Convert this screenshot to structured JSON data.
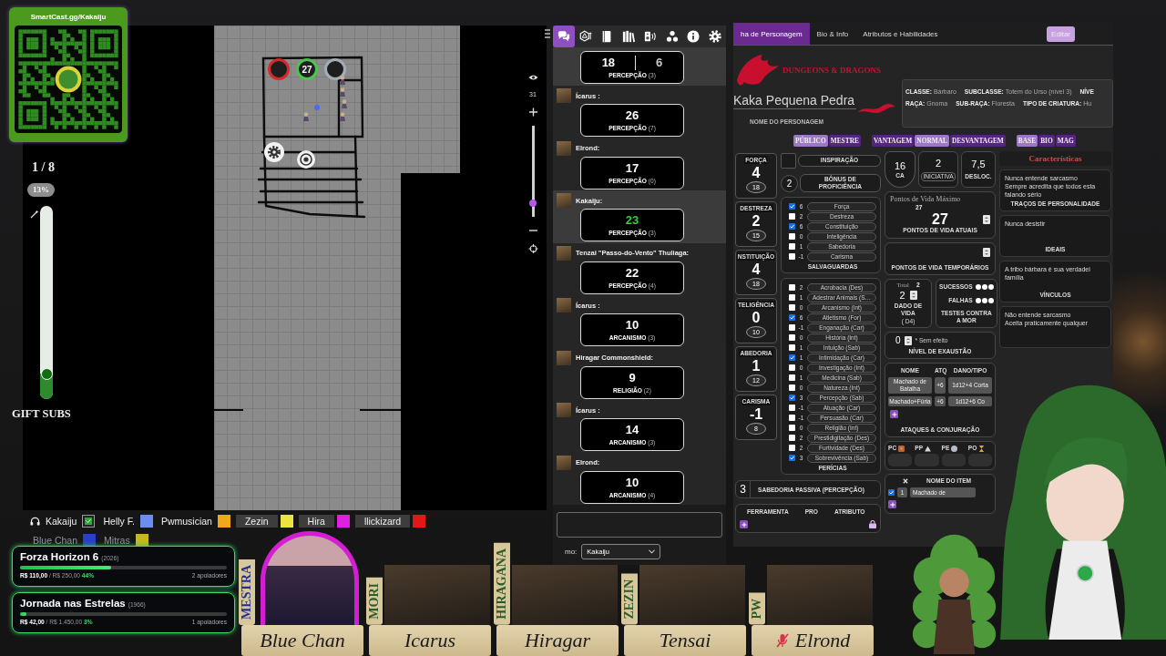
{
  "qr_widget": {
    "url": "SmartCast.gg/Kakaiju"
  },
  "gift_subs": {
    "count": "1 / 8",
    "percent": "13%",
    "level": 0.13,
    "label": "GIFT SUBS"
  },
  "map": {
    "tokens": [
      {
        "color": "#d42a2a"
      },
      {
        "color": "#4cc24f",
        "label": "27"
      },
      {
        "color": "#a3adb9"
      }
    ],
    "zoom_slider": {
      "value": "31",
      "level": 0.12
    }
  },
  "chat": {
    "tabs": [
      {
        "selected": true
      },
      {
        "selected": false
      },
      {
        "selected": false
      },
      {
        "selected": false
      },
      {
        "selected": false
      },
      {
        "selected": false
      },
      {
        "selected": false
      },
      {
        "selected": false
      }
    ],
    "messages": [
      {
        "results": [
          "18",
          "6"
        ],
        "skill": "PERCEPÇÃO",
        "bonus": "(3)",
        "highlighted": true,
        "crit": false
      },
      {
        "speaker": "Ícarus :",
        "results": [
          "26"
        ],
        "skill": "PERCEPÇÃO",
        "bonus": "(7)",
        "highlighted": false,
        "crit": false
      },
      {
        "speaker": "Elrond:",
        "results": [
          "17"
        ],
        "skill": "PERCEPÇÃO",
        "bonus": "(0)",
        "highlighted": false,
        "crit": false
      },
      {
        "speaker": "Kakaiju:",
        "results": [
          "23"
        ],
        "skill": "PERCEPÇÃO",
        "bonus": "(3)",
        "highlighted": true,
        "crit": true
      },
      {
        "speaker": "Tenzai \"Passo-do-Vento\" Thuliaga:",
        "results": [
          "22"
        ],
        "skill": "PERCEPÇÃO",
        "bonus": "(4)",
        "highlighted": false,
        "crit": false
      },
      {
        "speaker": "Ícarus :",
        "results": [
          "10"
        ],
        "skill": "ARCANISMO",
        "bonus": "(3)",
        "highlighted": false,
        "crit": false
      },
      {
        "speaker": "Hiragar Commonshield:",
        "results": [
          "9"
        ],
        "skill": "RELIGIÃO",
        "bonus": "(2)",
        "highlighted": false,
        "crit": false
      },
      {
        "speaker": "Ícarus :",
        "results": [
          "14"
        ],
        "skill": "ARCANISMO",
        "bonus": "(3)",
        "highlighted": false,
        "crit": false
      },
      {
        "speaker": "Elrond:",
        "results": [
          "10"
        ],
        "skill": "ARCANISMO",
        "bonus": "(4)",
        "highlighted": false,
        "crit": false
      }
    ],
    "speaking_as": {
      "label": "mo:",
      "value": "Kakaiju"
    }
  },
  "character_sheet": {
    "tabs": [
      {
        "label": "ha de Personagem",
        "selected": true
      },
      {
        "label": "Bio & Info",
        "selected": false
      },
      {
        "label": "Atributos e Habilidades",
        "selected": false
      }
    ],
    "edit_button": "Editar",
    "logo_text": "DUNGEONS & DRAGONS",
    "name": "Kaka Pequena Pedra",
    "name_label": "NOME DO PERSONAGEM",
    "details": [
      [
        {
          "label": "CLASSE:",
          "value": "Bárbaro"
        },
        {
          "label": "SUBCLASSE:",
          "value": "Totem do Urso (nível 3)"
        },
        {
          "label": "NÍVE"
        }
      ],
      [
        {
          "label": "RAÇA:",
          "value": "Gnoma"
        },
        {
          "label": "SUB-RAÇA:",
          "value": "Floresta"
        },
        {
          "label": "TIPO DE CRIATURA:",
          "value": "Hu"
        }
      ]
    ],
    "toggle_groups": [
      [
        {
          "label": "PÚBLICO",
          "selected": true
        },
        {
          "label": "MESTRE",
          "selected": false
        }
      ],
      [
        {
          "label": "VANTAGEM",
          "selected": false
        },
        {
          "label": "NORMAL",
          "selected": true
        },
        {
          "label": "DESVANTAGEM",
          "selected": false
        }
      ],
      [
        {
          "label": "BASE",
          "selected": true
        },
        {
          "label": "BIO",
          "selected": false
        },
        {
          "label": "MAG",
          "selected": false
        }
      ]
    ],
    "abilities": [
      {
        "name": "FORÇA",
        "modifier": "4",
        "score": "18"
      },
      {
        "name": "DESTREZA",
        "modifier": "2",
        "score": "15"
      },
      {
        "name": "NSTITUIÇÃO",
        "modifier": "4",
        "score": "18"
      },
      {
        "name": "TELIGÊNCIA",
        "modifier": "0",
        "score": "10"
      },
      {
        "name": "ABEDORIA",
        "modifier": "1",
        "score": "12"
      },
      {
        "name": "CARISMA",
        "modifier": "-1",
        "score": "8"
      }
    ],
    "inspiration": "INSPIRAÇÃO",
    "proficiency": {
      "value": "2",
      "label": "BÔNUS DE PROFICIÊNCIA"
    },
    "saving_throws": {
      "title": "SALVAGUARDAS",
      "items": [
        {
          "checked": true,
          "value": "6",
          "name": "Força"
        },
        {
          "checked": false,
          "value": "2",
          "name": "Destreza"
        },
        {
          "checked": true,
          "value": "6",
          "name": "Constituição"
        },
        {
          "checked": false,
          "value": "0",
          "name": "Inteligência"
        },
        {
          "checked": false,
          "value": "1",
          "name": "Sabedoria"
        },
        {
          "checked": false,
          "value": "-1",
          "name": "Carisma"
        }
      ]
    },
    "skills": {
      "title": "PERÍCIAS",
      "items": [
        {
          "checked": false,
          "value": "2",
          "name": "Acrobacia (Des)"
        },
        {
          "checked": false,
          "value": "1",
          "name": "Adestrar Animais (S…"
        },
        {
          "checked": false,
          "value": "0",
          "name": "Arcanismo (Int)"
        },
        {
          "checked": true,
          "value": "6",
          "name": "Atletismo (For)"
        },
        {
          "checked": false,
          "value": "-1",
          "name": "Enganação (Car)"
        },
        {
          "checked": false,
          "value": "0",
          "name": "História (Int)"
        },
        {
          "checked": false,
          "value": "1",
          "name": "Intuição (Sab)"
        },
        {
          "checked": true,
          "value": "1",
          "name": "Intimidação (Car)"
        },
        {
          "checked": false,
          "value": "0",
          "name": "Investigação (Int)"
        },
        {
          "checked": false,
          "value": "1",
          "name": "Medicina (Sab)"
        },
        {
          "checked": false,
          "value": "0",
          "name": "Natureza (Int)"
        },
        {
          "checked": true,
          "value": "3",
          "name": "Percepção (Sab)"
        },
        {
          "checked": false,
          "value": "-1",
          "name": "Atuação (Car)"
        },
        {
          "checked": false,
          "value": "-1",
          "name": "Persuasão (Car)"
        },
        {
          "checked": false,
          "value": "0",
          "name": "Religião (Int)"
        },
        {
          "checked": false,
          "value": "2",
          "name": "Prestidigitação (Des)"
        },
        {
          "checked": false,
          "value": "2",
          "name": "Furtividade (Des)"
        },
        {
          "checked": true,
          "value": "3",
          "name": "Sobrevivência (Sab)"
        }
      ]
    },
    "passive_perception": {
      "value": "3",
      "label": "SABEDORIA PASSIVA (PERCEPÇÃO)"
    },
    "tools": {
      "columns": [
        "FERRAMENTA",
        "PRO",
        "ATRIBUTO"
      ]
    },
    "armor_class": {
      "value": "16",
      "label": "CA"
    },
    "initiative": {
      "value": "2",
      "label": "INICIATIVA"
    },
    "speed": {
      "value": "7,5",
      "label": "DESLOC."
    },
    "hit_points": {
      "max_label": "Pontos de Vida Máximo",
      "max": "27",
      "current": "27",
      "current_label": "PONTOS DE VIDA ATUAIS",
      "temp_label": "PONTOS DE VIDA TEMPORÁRIOS"
    },
    "hit_dice": {
      "total_label": "Total",
      "total": "2",
      "value": "2",
      "label": "DADO DE VIDA",
      "die": "( D4)"
    },
    "death_saves": {
      "successes_label": "SUCESSOS",
      "successes": [
        {
          "checked": false
        },
        {
          "checked": false
        },
        {
          "checked": false
        }
      ],
      "failures_label": "FALHAS",
      "failures": [
        {
          "checked": false
        },
        {
          "checked": false
        },
        {
          "checked": false
        }
      ],
      "label": "TESTES CONTRA A MOR"
    },
    "exhaustion": {
      "value": "0",
      "note": "* Sem efeito",
      "label": "NÍVEL DE EXAUSTÃO"
    },
    "attacks": {
      "columns": [
        "NOME",
        "ATQ",
        "DANO/TIPO"
      ],
      "rows": [
        {
          "name": "Machado de Batalha",
          "attack": "+6",
          "damage": "1d12+4 Corta"
        },
        {
          "name": "Machado+Fúria",
          "attack": "+6",
          "damage": "1d12+6 Co"
        }
      ],
      "title": "ATAQUES & CONJURAÇÃO"
    },
    "coins": [
      "PC",
      "PP",
      "PE",
      "PO"
    ],
    "inventory": {
      "column": "NOME DO ITEM",
      "items": [
        {
          "checked": true,
          "quantity": "1",
          "name": "Machado de"
        }
      ]
    },
    "traits": {
      "title": "Características",
      "entries": [
        {
          "lines": [
            "Nunca entende sarcasmo",
            "Sempre acredita que todos esta",
            "falando sério"
          ],
          "label": "TRAÇOS DE PERSONALIDADE"
        },
        {
          "lines": [
            "Nunca desistir"
          ],
          "label": "IDEAIS"
        },
        {
          "lines": [
            "A tribo bárbara é sua verdadei",
            "família"
          ],
          "label": "VÍNCULOS"
        },
        {
          "lines": [
            "Não entende sarcasmo",
            "Aceita praticamente qualquer"
          ]
        }
      ]
    }
  },
  "voice_channel": {
    "rows": [
      [
        {
          "name": "Kakaiju",
          "color": "#2ea83c",
          "kind": "self",
          "highlighted": false
        },
        {
          "name": "Helly F.",
          "color": "#6b8cf0",
          "kind": "member",
          "highlighted": false
        },
        {
          "name": "Pwmusician",
          "color": "#f0a818",
          "kind": "member",
          "highlighted": false
        },
        {
          "name": "Zezin",
          "color": "#ece440",
          "kind": "member",
          "highlighted": true
        },
        {
          "name": "Hira",
          "color": "#e020e0",
          "kind": "member",
          "highlighted": true
        },
        {
          "name": "llickizard",
          "color": "#e01818",
          "kind": "member",
          "highlighted": true
        }
      ],
      [
        {
          "name": "Blue Chan",
          "color": "#2840c8",
          "kind": "member",
          "highlighted": false
        },
        {
          "name": "Mitras",
          "color": "#c8b820",
          "kind": "member",
          "highlighted": false
        }
      ]
    ]
  },
  "goals": [
    {
      "title": "Forza Horizon 6",
      "year": "(2026)",
      "raised": "R$ 110,00",
      "target": "/ R$ 250,00",
      "percent": "44%",
      "level": 0.44,
      "backers": "2 apoiadores"
    },
    {
      "title": "Jornada nas Estrelas",
      "year": "(1966)",
      "raised": "R$ 42,00",
      "target": "/ R$ 1.450,00",
      "percent": "3%",
      "level": 0.03,
      "backers": "1 apoiadores"
    }
  ],
  "party": [
    {
      "tag": "MESTRA",
      "kind": "gm",
      "name": "Blue Chan",
      "muted": false,
      "speaking": true
    },
    {
      "tag": "MORI",
      "kind": "player",
      "name": "Icarus",
      "muted": false,
      "speaking": false
    },
    {
      "tag": "HIRAGANA",
      "kind": "player",
      "name": "Hiragar",
      "muted": false,
      "speaking": false
    },
    {
      "tag": "ZEZIN",
      "kind": "player",
      "name": "Tensai",
      "muted": false,
      "speaking": false
    },
    {
      "tag": "PW",
      "kind": "player",
      "name": "Elrond",
      "muted": true,
      "speaking": false
    }
  ]
}
